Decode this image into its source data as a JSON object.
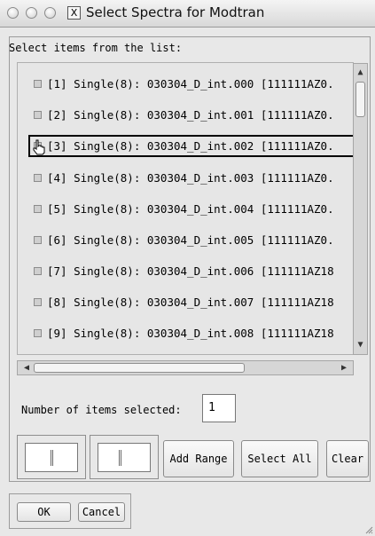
{
  "window": {
    "title": "Select Spectra for Modtran"
  },
  "prompt": "Select items from the list:",
  "items": [
    "[1] Single(8): 030304_D_int.000 [111111AZ0.",
    "[2] Single(8): 030304_D_int.001 [111111AZ0.",
    "[3] Single(8): 030304_D_int.002 [111111AZ0.",
    "[4] Single(8): 030304_D_int.003 [111111AZ0.",
    "[5] Single(8): 030304_D_int.004 [111111AZ0.",
    "[6] Single(8): 030304_D_int.005 [111111AZ0.",
    "[7] Single(8): 030304_D_int.006 [111111AZ18",
    "[8] Single(8): 030304_D_int.007 [111111AZ18",
    "[9] Single(8): 030304_D_int.008 [111111AZ18"
  ],
  "selection": {
    "label": "Number of items selected:",
    "count": "1"
  },
  "range": {
    "add_label": "Add Range",
    "start": "",
    "end": ""
  },
  "buttons": {
    "select_all": "Select All",
    "clear": "Clear",
    "ok": "OK",
    "cancel": "Cancel"
  }
}
